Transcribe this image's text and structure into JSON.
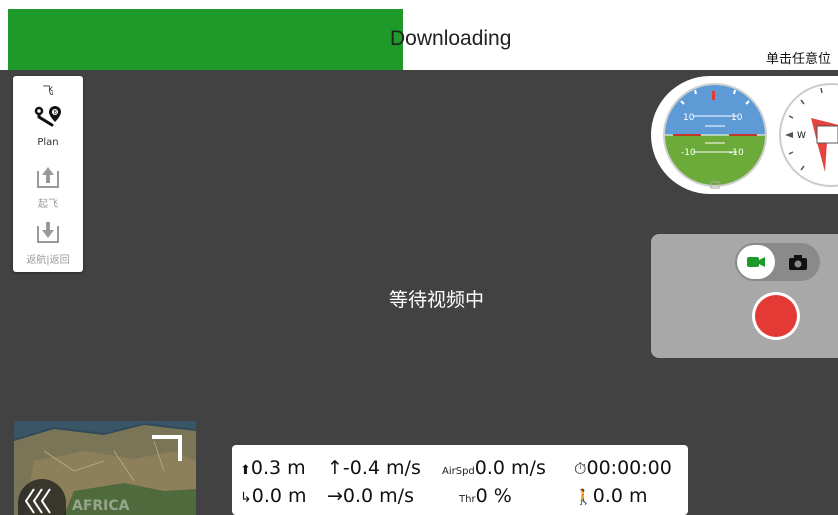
{
  "download": {
    "status_text": "Downloading",
    "progress_percent": 48,
    "bar_color": "#1e9a2a"
  },
  "hint": {
    "text": "单击任意位"
  },
  "toolbar": {
    "top_glyph": "飞",
    "plan_label": "Plan",
    "takeoff_label": "起飞",
    "rtl_label": "返航|返回"
  },
  "video": {
    "status_text": "等待视频中"
  },
  "instrument": {
    "attitude_labels": {
      "up_left": "10",
      "up_right": "10",
      "down_left": "-10",
      "down_right": "-10"
    },
    "compass_west": "W"
  },
  "camera": {
    "video_mode_icon": "video-camera-icon",
    "photo_mode_icon": "photo-camera-icon",
    "record_color": "#e53935"
  },
  "minimap": {
    "region_label": "AFRICA"
  },
  "telemetry": {
    "altitude": "0.3 m",
    "vertical_speed": "-0.4 m/s",
    "airspeed_label": "AirSpd",
    "airspeed": "0.0 m/s",
    "flight_time": "00:00:00",
    "distance_to_home": "0.0 m",
    "ground_speed": "0.0 m/s",
    "throttle_label": "Thr",
    "throttle": "0 %",
    "distance": "0.0 m"
  },
  "colors": {
    "background": "#424242",
    "accent": "#1e9a2a",
    "record": "#e53935"
  }
}
